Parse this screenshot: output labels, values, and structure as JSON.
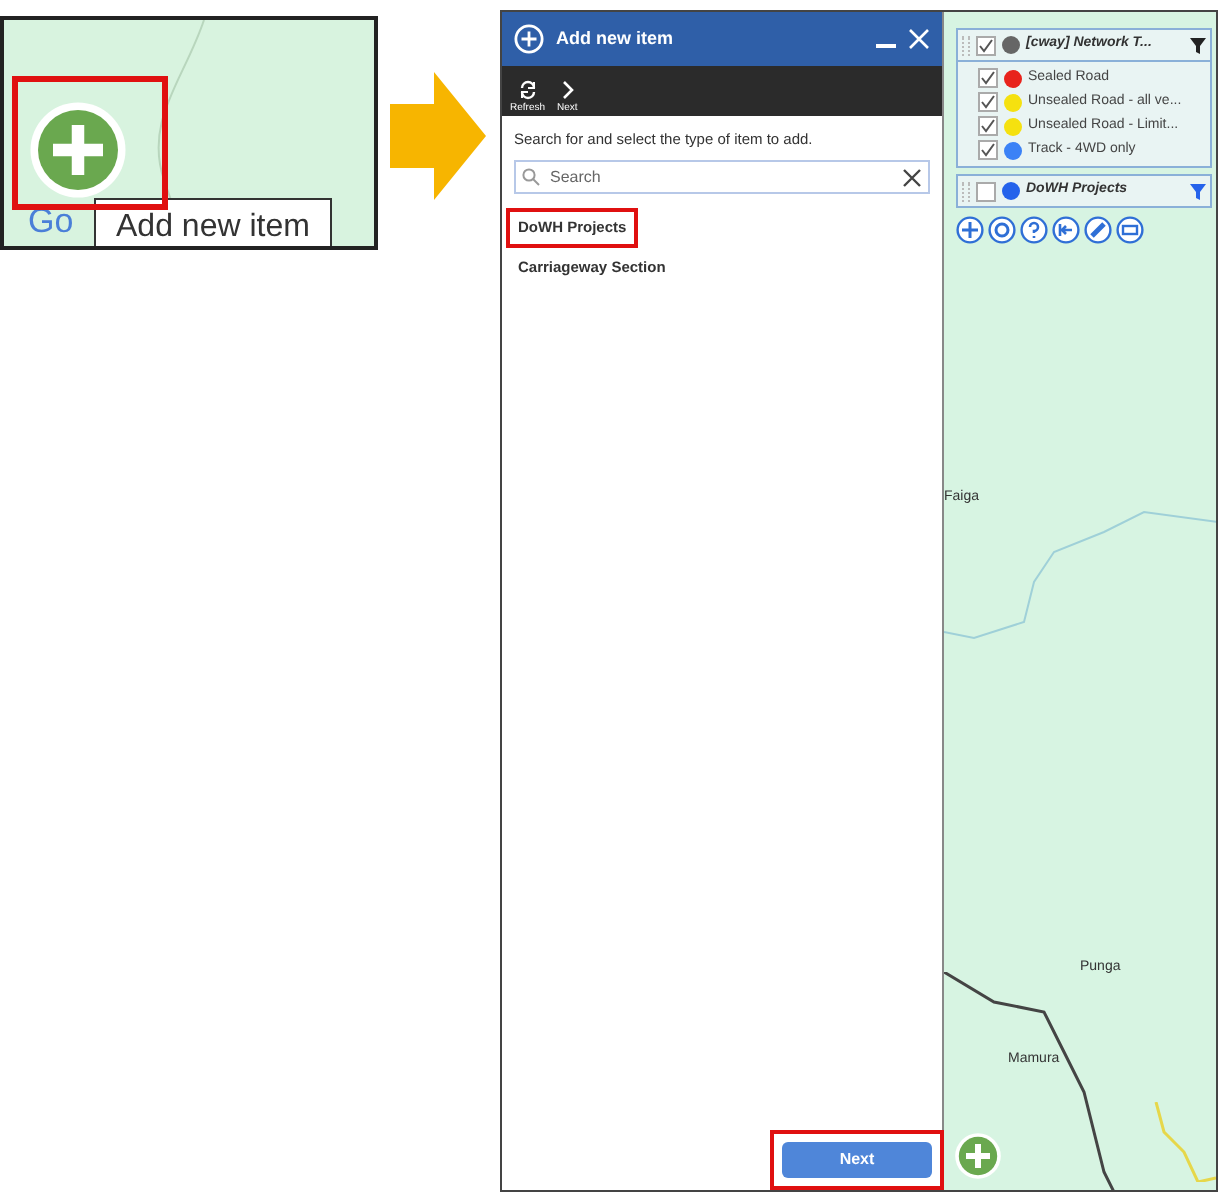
{
  "snapshot": {
    "tooltip": "Add new item",
    "map_logo": "Go",
    "highlighted": true
  },
  "dialog": {
    "title": "Add new item",
    "toolbar": [
      {
        "label": "Refresh",
        "kind": "refresh"
      },
      {
        "label": "Next",
        "kind": "next"
      }
    ],
    "instruction": "Search for and select the type of item to add.",
    "search": {
      "placeholder": "Search"
    },
    "items": [
      {
        "label": "DoWH Projects",
        "highlighted": true
      },
      {
        "label": "Carriageway Section",
        "highlighted": false
      }
    ],
    "next_button": {
      "label": "Next",
      "highlighted": true
    }
  },
  "layers": [
    {
      "name": "[cway] Network T...",
      "checked": true,
      "color": "#666666",
      "children": [
        {
          "name": "Sealed Road",
          "checked": true,
          "color": "#e8231c"
        },
        {
          "name": "Unsealed Road - all ve...",
          "checked": true,
          "color": "#f5e10f"
        },
        {
          "name": "Unsealed Road - Limit...",
          "checked": true,
          "color": "#f5e10f"
        },
        {
          "name": "Track - 4WD only",
          "checked": true,
          "color": "#3b82f6"
        }
      ]
    },
    {
      "name": "DoWH Projects",
      "checked": false,
      "color": "#2563eb"
    }
  ],
  "map_labels": [
    "Faiga",
    "Punga",
    "Mamura"
  ]
}
